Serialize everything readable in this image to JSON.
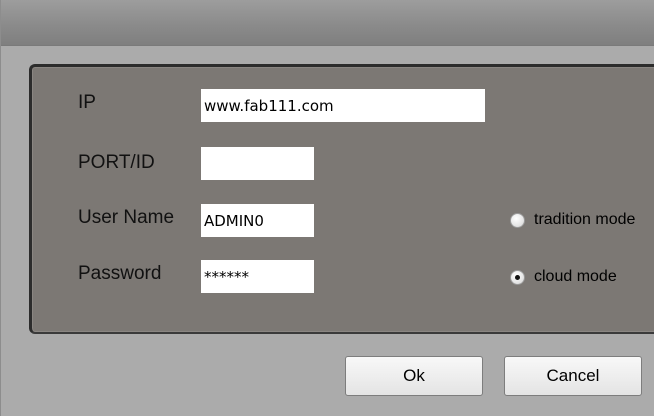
{
  "dialog": {
    "fields": {
      "ip": {
        "label": "IP",
        "value": "www.fab111.com"
      },
      "port": {
        "label": "PORT/ID",
        "value": ""
      },
      "username": {
        "label": "User Name",
        "value": "ADMIN0"
      },
      "password": {
        "label": "Password",
        "value": "******"
      }
    },
    "mode": {
      "options": [
        {
          "label": "tradition mode",
          "selected": false
        },
        {
          "label": "cloud mode",
          "selected": true
        }
      ]
    },
    "buttons": {
      "ok": "Ok",
      "cancel": "Cancel"
    }
  }
}
